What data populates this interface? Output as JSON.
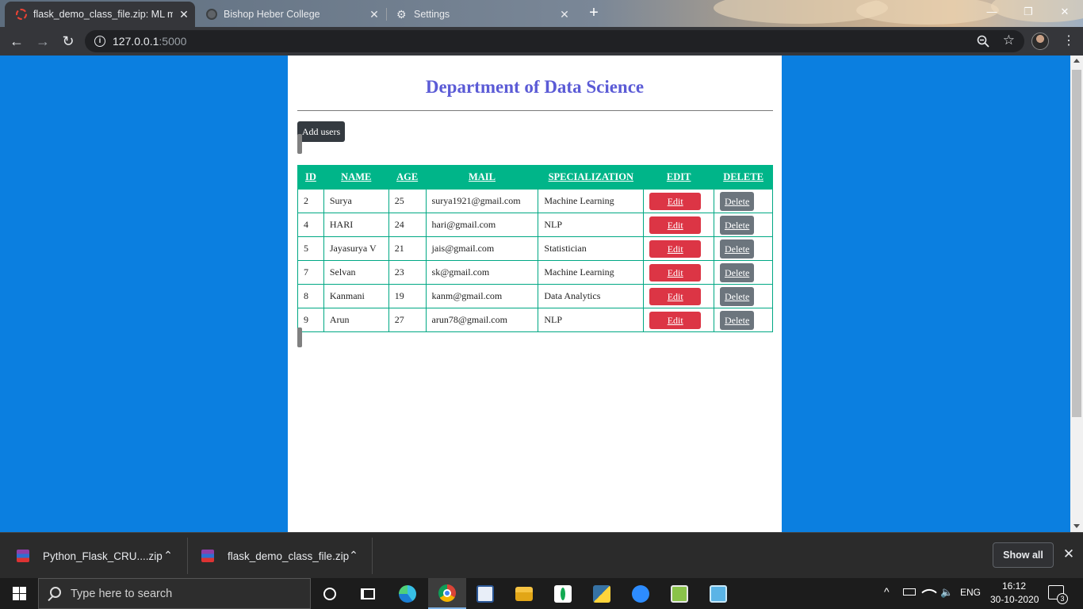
{
  "browser": {
    "tabs": [
      {
        "title": "flask_demo_class_file.zip: ML mas",
        "close": "✕"
      },
      {
        "title": "Bishop Heber College",
        "close": "✕"
      },
      {
        "title": "Settings",
        "close": "✕"
      }
    ],
    "new_tab": "+",
    "window_controls": {
      "minimize": "—",
      "restore": "❐",
      "close": "✕"
    },
    "nav": {
      "back": "←",
      "forward": "→",
      "reload": "↻"
    },
    "url_host": "127.0.0.1",
    "url_port": ":5000",
    "info_glyph": "i",
    "star_glyph": "☆",
    "menu_glyph": "⋮"
  },
  "page": {
    "title": "Department of Data Science",
    "add_users_label": "Add users",
    "table": {
      "headers": [
        "ID",
        "NAME",
        "AGE",
        "MAIL",
        "SPECIALIZATION",
        "EDIT",
        "DELETE"
      ],
      "rows": [
        {
          "id": "2",
          "name": "Surya",
          "age": "25",
          "mail": "surya1921@gmail.com",
          "spec": "Machine Learning",
          "edit": "Edit",
          "delete": "Delete"
        },
        {
          "id": "4",
          "name": "HARI",
          "age": "24",
          "mail": "hari@gmail.com",
          "spec": "NLP",
          "edit": "Edit",
          "delete": "Delete"
        },
        {
          "id": "5",
          "name": "Jayasurya V",
          "age": "21",
          "mail": "jais@gmail.com",
          "spec": "Statistician",
          "edit": "Edit",
          "delete": "Delete"
        },
        {
          "id": "7",
          "name": "Selvan",
          "age": "23",
          "mail": "sk@gmail.com",
          "spec": "Machine Learning",
          "edit": "Edit",
          "delete": "Delete"
        },
        {
          "id": "8",
          "name": "Kanmani",
          "age": "19",
          "mail": "kanm@gmail.com",
          "spec": "Data Analytics",
          "edit": "Edit",
          "delete": "Delete"
        },
        {
          "id": "9",
          "name": "Arun",
          "age": "27",
          "mail": "arun78@gmail.com",
          "spec": "NLP",
          "edit": "Edit",
          "delete": "Delete"
        }
      ]
    }
  },
  "downloads": {
    "items": [
      {
        "name": "Python_Flask_CRU....zip",
        "caret": "⌃"
      },
      {
        "name": "flask_demo_class_file.zip",
        "caret": "⌃"
      }
    ],
    "show_all": "Show all",
    "close": "✕"
  },
  "taskbar": {
    "search_placeholder": "Type here to search",
    "tray": {
      "language": "ENG",
      "time": "16:12",
      "date": "30-10-2020",
      "notifications": "3",
      "chevron": "^"
    }
  },
  "colors": {
    "page_background": "#0b7fe0",
    "title": "#5b5bd6",
    "table_header": "#00b589",
    "edit_button": "#dc3545",
    "delete_button": "#6c757d",
    "add_users_button": "#343a40"
  },
  "icons": [
    "tab-favicon-icon",
    "globe-icon",
    "gear-icon",
    "back-icon",
    "forward-icon",
    "reload-icon",
    "info-icon",
    "zoom-icon",
    "star-icon",
    "profile-avatar",
    "menu-icon",
    "zip-file-icon",
    "windows-start-icon",
    "search-icon",
    "cortana-icon",
    "task-view-icon",
    "edge-icon",
    "chrome-icon",
    "file-explorer-icon",
    "mongodb-icon",
    "python-icon",
    "zoom-app-icon",
    "battery-icon",
    "wifi-icon",
    "volume-icon",
    "notification-icon"
  ]
}
